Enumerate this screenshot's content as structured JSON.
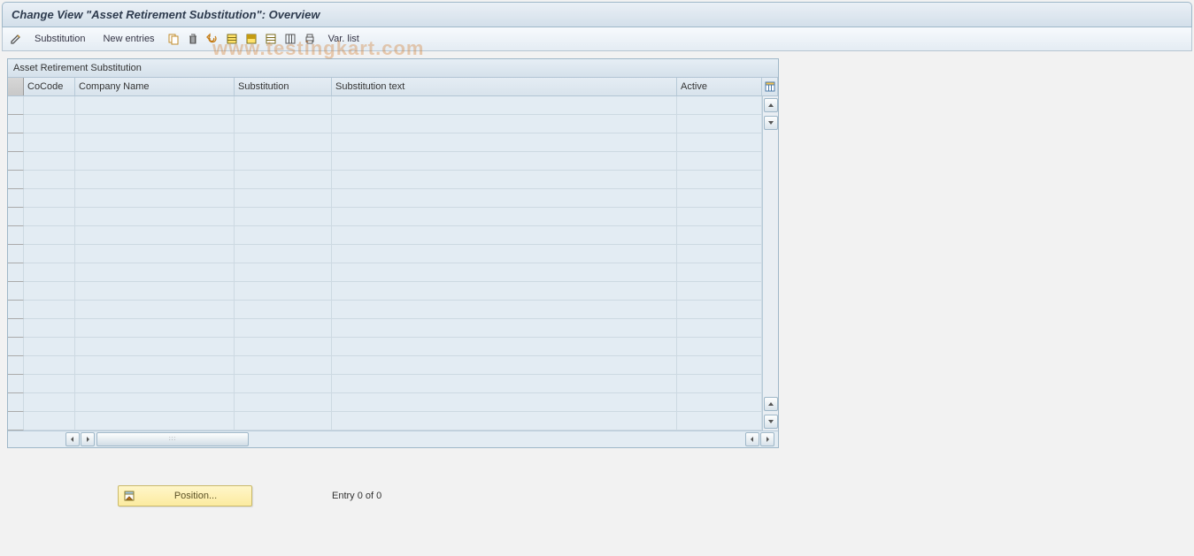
{
  "header": {
    "title": "Change View \"Asset Retirement Substitution\": Overview"
  },
  "toolbar": {
    "substitution_label": "Substitution",
    "new_entries_label": "New entries",
    "var_list_label": "Var. list"
  },
  "grid": {
    "title": "Asset Retirement Substitution",
    "columns": {
      "cocode": "CoCode",
      "company_name": "Company Name",
      "substitution": "Substitution",
      "substitution_text": "Substitution text",
      "active": "Active"
    },
    "row_count": 18
  },
  "footer": {
    "position_label": "Position...",
    "entry_text": "Entry 0 of 0"
  },
  "watermark": "www.testingkart.com"
}
